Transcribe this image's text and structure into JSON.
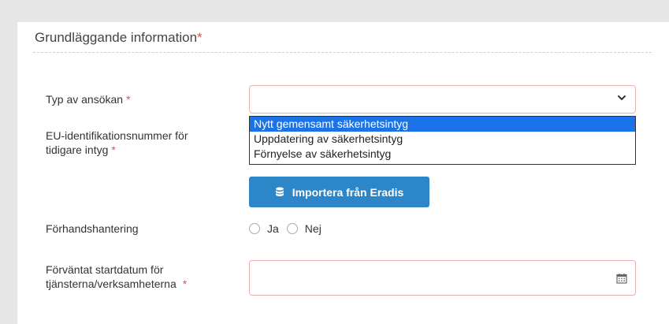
{
  "section": {
    "title": "Grundläggande information",
    "required_mark": "*"
  },
  "fields": {
    "application_type": {
      "label": "Typ av ansökan",
      "required_mark": "*",
      "value": ""
    },
    "eu_id": {
      "label_line1": "EU-identifikationsnummer för",
      "label_line2": "tidigare intyg",
      "required_mark": "*"
    },
    "pre_handling": {
      "label": "Förhandshantering",
      "options": [
        "Ja",
        "Nej"
      ]
    },
    "start_date": {
      "label_line1": "Förväntat startdatum för",
      "label_line2": "tjänsterna/verksamheterna",
      "required_mark": "*"
    }
  },
  "dropdown": {
    "options": [
      "Nytt gemensamt säkerhetsintyg",
      "Uppdatering av säkerhetsintyg",
      "Förnyelse av säkerhetsintyg"
    ],
    "highlighted_index": 0
  },
  "import_button": {
    "label": "Importera från Eradis",
    "icon": "database-icon"
  },
  "colors": {
    "accent": "#2c86c7",
    "highlight": "#1a73e8",
    "required": "#d9534f",
    "invalid_border": "#e4b2b0"
  }
}
